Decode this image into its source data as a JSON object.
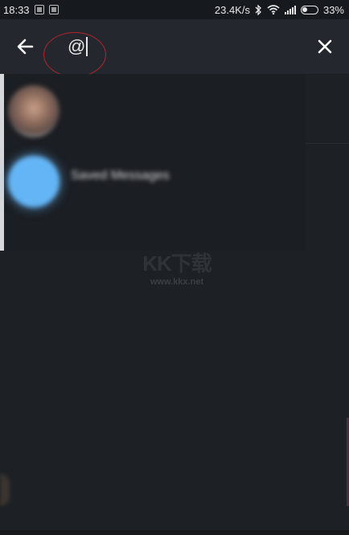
{
  "status_bar": {
    "time": "18:33",
    "network_speed": "23.4K/s",
    "battery_percent": "33%"
  },
  "search": {
    "query": "@",
    "back_icon": "arrow-left-icon",
    "close_icon": "close-icon"
  },
  "results": [
    {
      "name": "",
      "subtitle": ""
    },
    {
      "name": "Saved Messages",
      "subtitle": ""
    }
  ],
  "watermark": {
    "top": "KK下载",
    "bottom": "www.kkx.net"
  },
  "colors": {
    "background": "#1d2126",
    "search_bar": "#24282e",
    "annotation": "#b3262b",
    "accent_avatar": "#64b5f6"
  }
}
